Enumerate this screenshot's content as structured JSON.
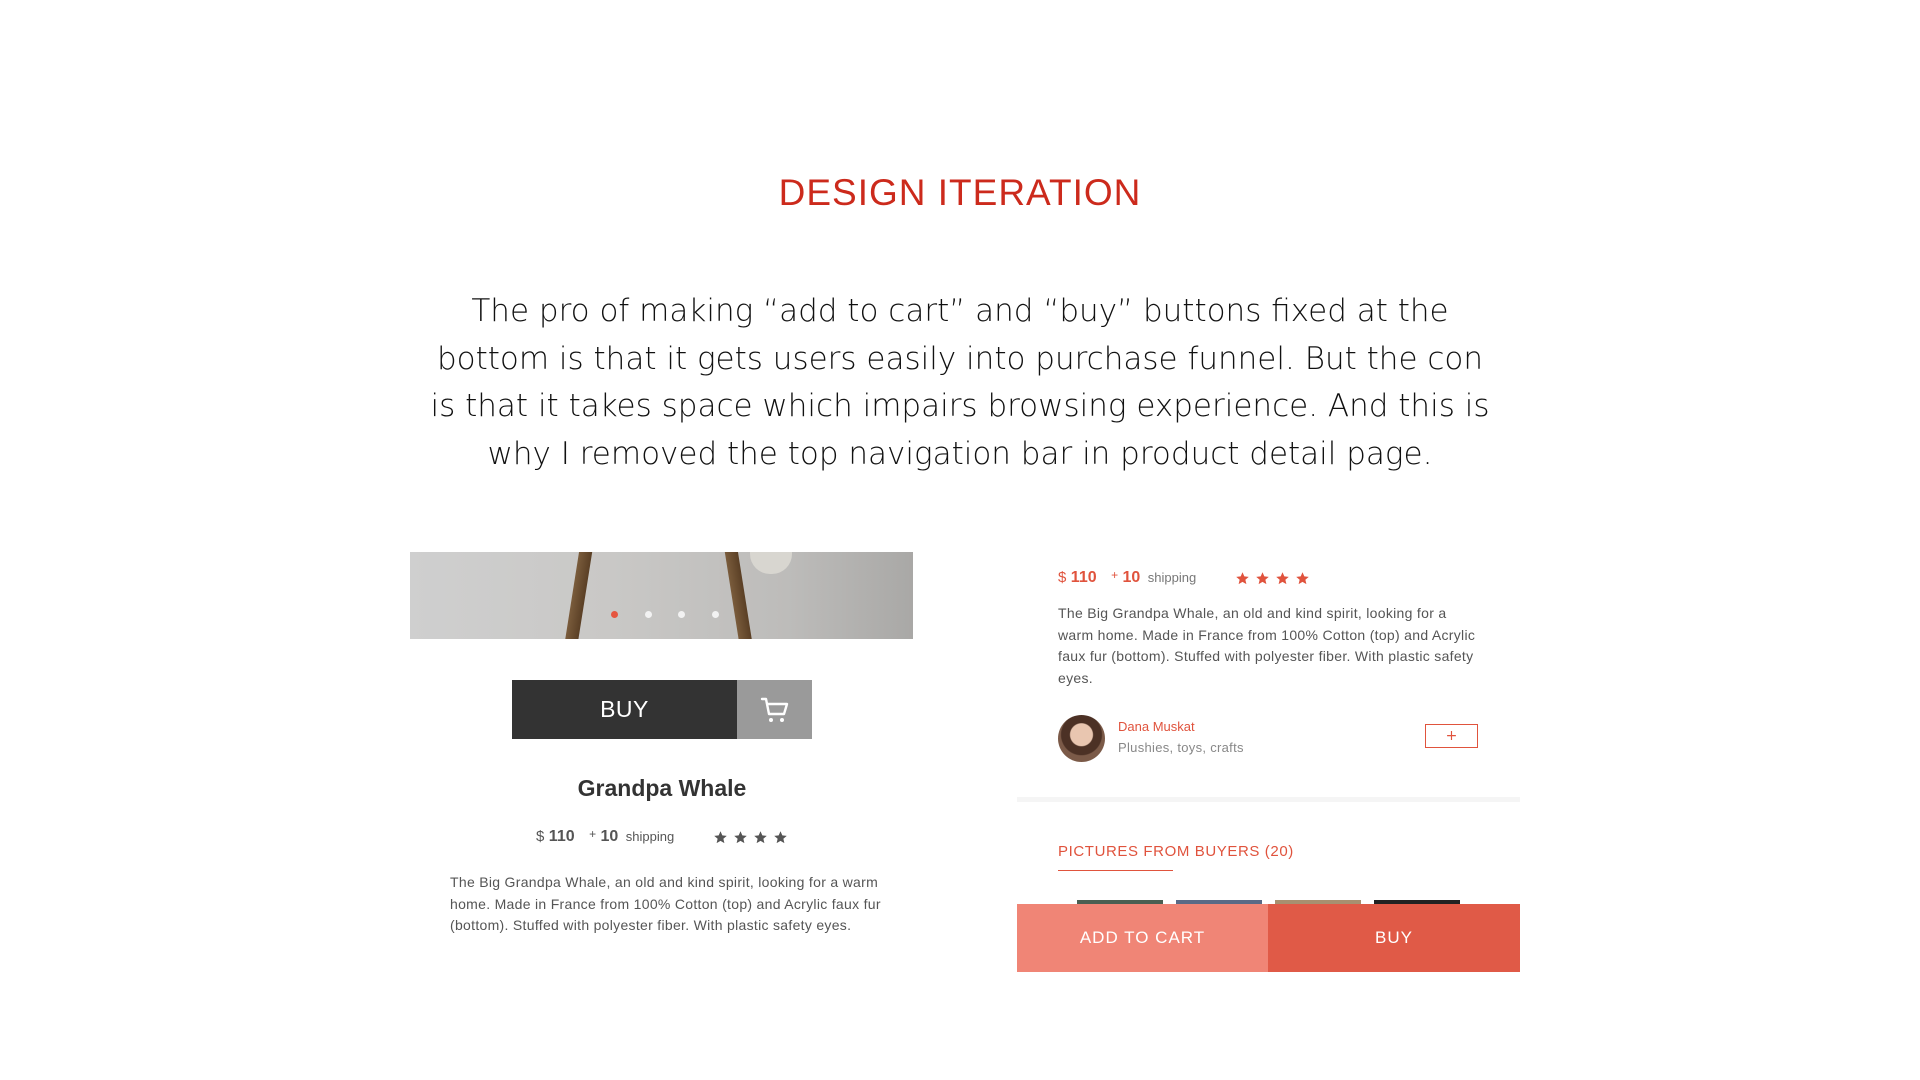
{
  "heading": "DESIGN ITERATION",
  "intro": "The pro of making “add to cart” and “buy” buttons fixed at the bottom is that it gets users easily into purchase funnel. But the con is that it takes space which impairs browsing experience. And this is why I removed the top navigation bar in product detail page.",
  "left_mockup": {
    "carousel": {
      "dots": 4,
      "active_index": 0
    },
    "buy_label": "BUY",
    "cart_icon": "shopping-cart-icon",
    "product_name": "Grandpa Whale",
    "currency": "$",
    "price": "110",
    "shipping_plus": "+",
    "shipping_amount": "10",
    "shipping_label": "shipping",
    "rating": 4,
    "star_color": "#555555",
    "description": "The Big Grandpa Whale, an old and kind spirit, looking for a warm home. Made in France from 100% Cotton (top) and Acrylic faux fur (bottom). Stuffed with polyester fiber. With plastic safety eyes."
  },
  "right_mockup": {
    "currency": "$",
    "price": "110",
    "shipping_plus": "+",
    "shipping_amount": "10",
    "shipping_label": "shipping",
    "rating": 4,
    "star_color": "#e0533d",
    "description": "The Big Grandpa Whale, an old and kind spirit, looking for a warm home. Made in France from 100% Cotton (top) and Acrylic faux fur (bottom). Stuffed with polyester fiber. With plastic safety eyes.",
    "seller": {
      "name": "Dana Muskat",
      "category": "Plushies, toys, crafts",
      "follow_label": "+"
    },
    "pictures_title": "PICTURES FROM BUYERS (20)",
    "add_to_cart_label": "ADD TO CART",
    "buy_label": "BUY"
  },
  "colors": {
    "accent": "#cc2a1c",
    "brand_red": "#e05a47",
    "brand_light": "#f08576",
    "dark_button": "#333333"
  }
}
